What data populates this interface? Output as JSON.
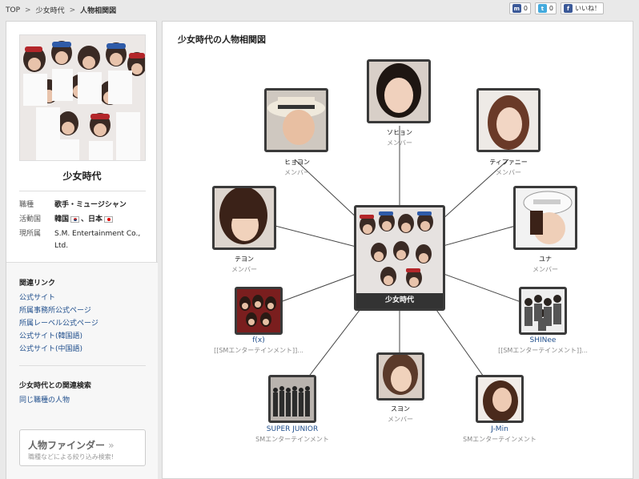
{
  "breadcrumb": [
    "TOP",
    "少女時代",
    "人物相関図"
  ],
  "breadcrumb_sep": ">",
  "share": [
    {
      "icon": "mixi-icon",
      "glyph": "m",
      "color": "#3b5998",
      "count": "0"
    },
    {
      "icon": "twitter-icon",
      "glyph": "t",
      "color": "#44aadd",
      "count": "0"
    },
    {
      "icon": "facebook-icon",
      "glyph": "f",
      "color": "#3b5998",
      "label": "いいね！"
    }
  ],
  "sidebar": {
    "name": "少女時代",
    "info": [
      {
        "key": "職種",
        "value": "歌手・ミュージシャン"
      },
      {
        "key": "活動国",
        "value_a": "韓国",
        "value_b": "、日本"
      },
      {
        "key": "現所属",
        "value": "S.M. Entertainment Co., Ltd."
      }
    ],
    "links_title": "関連リンク",
    "links": [
      "公式サイト",
      "所属事務所公式ページ",
      "所属レーベル公式ページ",
      "公式サイト(韓国語)",
      "公式サイト(中国語)"
    ],
    "search_title": "少女時代との関連検索",
    "search_links": [
      "同じ職種の人物"
    ],
    "finder_title": "人物ファインダー",
    "finder_arrow": "»",
    "finder_sub": "職種などによる絞り込み検索!"
  },
  "main": {
    "title": "少女時代の人物相関図",
    "center": {
      "name": "少女時代"
    },
    "nodes": [
      {
        "name": "ソヒョン",
        "role": "メンバー",
        "link": false
      },
      {
        "name": "ヒョヨン",
        "role": "メンバー",
        "link": false
      },
      {
        "name": "ティファニー",
        "role": "メンバー",
        "link": false
      },
      {
        "name": "テヨン",
        "role": "メンバー",
        "link": false
      },
      {
        "name": "ユナ",
        "role": "メンバー",
        "link": false
      },
      {
        "name": "f(x)",
        "role": "[[SMエンターテインメント]]...",
        "link": true
      },
      {
        "name": "SHINee",
        "role": "[[SMエンターテインメント]]...",
        "link": true
      },
      {
        "name": "SUPER JUNIOR",
        "role": "SMエンターテインメント",
        "link": true
      },
      {
        "name": "スヨン",
        "role": "メンバー",
        "link": false
      },
      {
        "name": "J-Min",
        "role": "SMエンターテインメント",
        "link": true
      }
    ]
  }
}
